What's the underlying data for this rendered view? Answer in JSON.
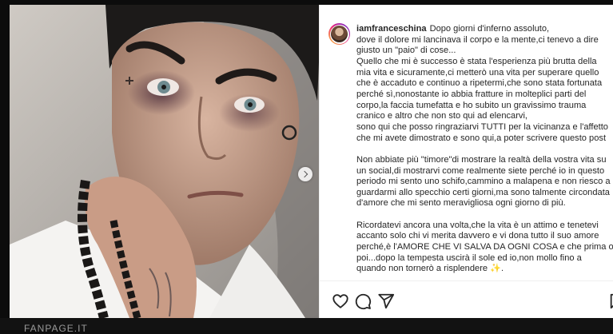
{
  "post": {
    "username": "iamfranceschina",
    "caption_lines": [
      "Dopo giorni d'inferno assoluto,",
      "dove il dolore mi lancinava il corpo e la mente,ci tenevo a dire",
      "giusto un \"paio\" di cose...",
      "Quello che mi è successo è stata l'esperienza più brutta della",
      "mia vita e sicuramente,ci metterò una vita per superare quello",
      "che è accaduto e continuo a ripetermi,che sono stata fortunata",
      "perché sì,nonostante io abbia fratture in molteplici parti del",
      "corpo,la faccia tumefatta e ho subito un gravissimo trauma",
      "cranico e altro che non sto qui ad elencarvi,",
      "sono qui che posso ringraziarvi TUTTI per la vicinanza e l'affetto",
      "che mi avete dimostrato e sono qui,a poter scrivere questo post",
      "",
      "Non abbiate più \"timore\"di mostrare la realtà della vostra vita su",
      "un social,di mostrarvi come realmente siete perché io in questo",
      "periodo mi sento uno schifo,cammino a malapena e non riesco a",
      "guardarmi allo specchio certi giorni,ma sono talmente circondata",
      "d'amore che mi sento meravigliosa ogni giorno di più.",
      "",
      "Ricordatevi ancora una volta,che la vita è un attimo e tenetevi",
      "accanto solo chi vi merita davvero e vi dona tutto il suo amore",
      "perché,è l'AMORE CHE VI SALVA DA OGNI COSA e che prima o",
      "poi...dopo la tempesta uscirà il sole ed io,non mollo fino a",
      "quando non tornerò a risplendere"
    ],
    "sparkle": "✨",
    "caption_end": "."
  },
  "icons": {
    "like": "heart-icon",
    "comment": "comment-icon",
    "share": "share-icon",
    "save": "bookmark-icon",
    "next": "chevron-right-icon"
  },
  "watermark": "FANPAGE.IT"
}
